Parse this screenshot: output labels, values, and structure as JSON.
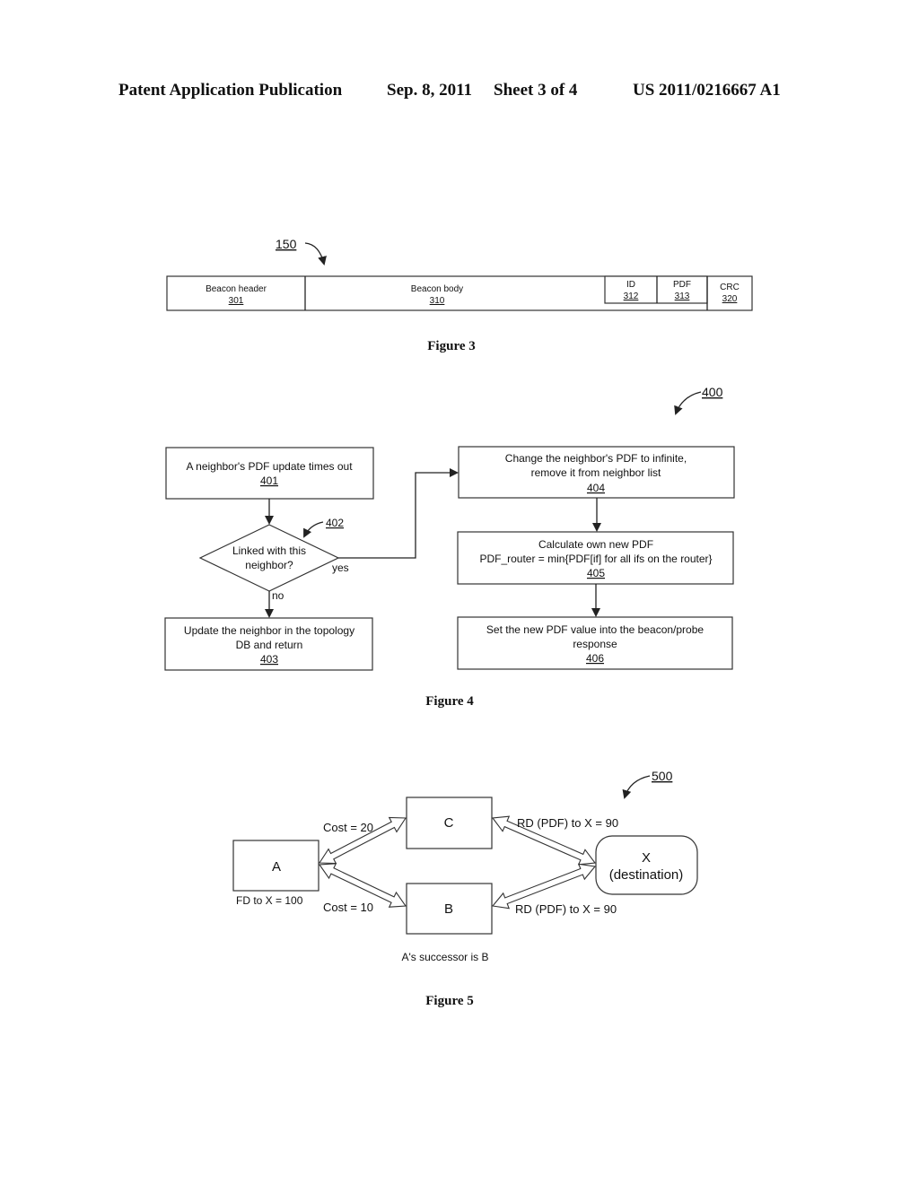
{
  "header": {
    "publication": "Patent Application Publication",
    "date": "Sep. 8, 2011",
    "sheet": "Sheet 3 of 4",
    "number": "US 2011/0216667 A1"
  },
  "figure3": {
    "ref": "150",
    "caption": "Figure 3",
    "fields": [
      {
        "label": "Beacon header",
        "ref": "301"
      },
      {
        "label": "Beacon body",
        "ref": "310"
      },
      {
        "label": "ID",
        "ref": "312"
      },
      {
        "label": "PDF",
        "ref": "313"
      },
      {
        "label": "CRC",
        "ref": "320"
      }
    ]
  },
  "figure4": {
    "ref": "400",
    "caption": "Figure 4",
    "steps": {
      "s401": {
        "lines": [
          "A neighbor's PDF update times out"
        ],
        "ref": "401"
      },
      "s402": {
        "lines": [
          "Linked with this",
          "neighbor?"
        ],
        "ref": "402",
        "yes": "yes",
        "no": "no"
      },
      "s403": {
        "lines": [
          "Update the neighbor in the topology",
          "DB and return"
        ],
        "ref": "403"
      },
      "s404": {
        "lines": [
          "Change the neighbor's PDF to infinite,",
          "remove it from neighbor list"
        ],
        "ref": "404"
      },
      "s405": {
        "lines": [
          "Calculate own new PDF",
          "PDF_router = min{PDF[if] for all ifs on the router}"
        ],
        "ref": "405"
      },
      "s406": {
        "lines": [
          "Set the new PDF value into the beacon/probe",
          "response"
        ],
        "ref": "406"
      }
    }
  },
  "figure5": {
    "ref": "500",
    "caption": "Figure 5",
    "nodes": {
      "A": {
        "label": "A",
        "note": "FD to X = 100"
      },
      "B": {
        "label": "B"
      },
      "C": {
        "label": "C"
      },
      "X": {
        "label": "X",
        "sublabel": "(destination)"
      }
    },
    "links": {
      "AC": "Cost = 20",
      "AB": "Cost = 10",
      "CX": "RD (PDF) to X = 90",
      "BX": "RD (PDF) to X = 90"
    },
    "note": "A's successor is B"
  }
}
